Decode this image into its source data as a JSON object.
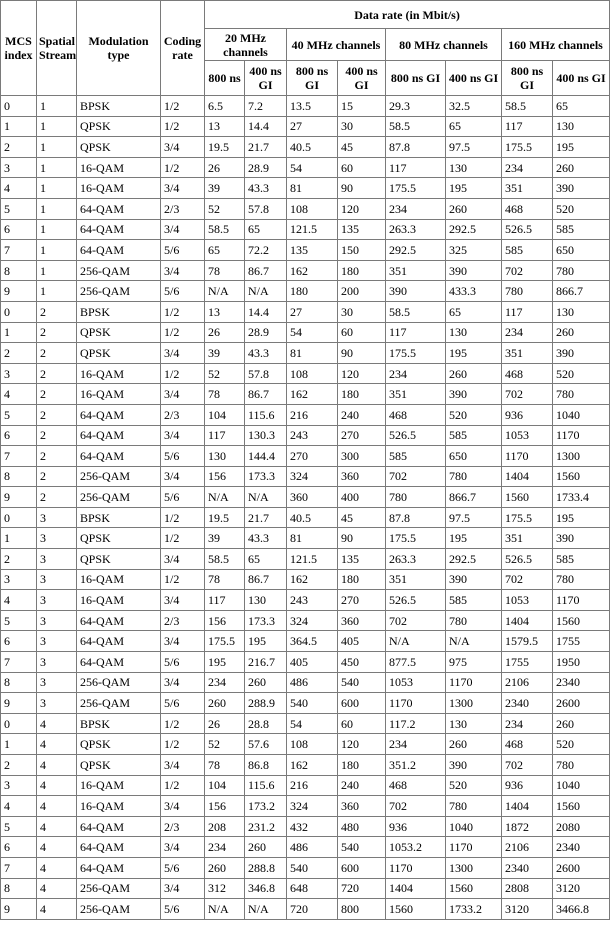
{
  "headers": {
    "mcs_index": "MCS index",
    "spatial_streams": "Spatial Streams",
    "modulation_type": "Modulation type",
    "coding_rate": "Coding rate",
    "data_rate": "Data rate (in Mbit/s)",
    "channels": [
      {
        "label": "20 MHz channels",
        "gi": [
          "800 ns",
          "400 ns GI"
        ]
      },
      {
        "label": "40 MHz channels",
        "gi": [
          "800 ns GI",
          "400 ns GI"
        ]
      },
      {
        "label": "80 MHz channels",
        "gi": [
          "800 ns GI",
          "400 ns GI"
        ]
      },
      {
        "label": "160 MHz channels",
        "gi": [
          "800 ns GI",
          "400 ns GI"
        ]
      }
    ]
  },
  "rows": [
    [
      "0",
      "1",
      "BPSK",
      "1/2",
      "6.5",
      "7.2",
      "13.5",
      "15",
      "29.3",
      "32.5",
      "58.5",
      "65"
    ],
    [
      "1",
      "1",
      "QPSK",
      "1/2",
      "13",
      "14.4",
      "27",
      "30",
      "58.5",
      "65",
      "117",
      "130"
    ],
    [
      "2",
      "1",
      "QPSK",
      "3/4",
      "19.5",
      "21.7",
      "40.5",
      "45",
      "87.8",
      "97.5",
      "175.5",
      "195"
    ],
    [
      "3",
      "1",
      "16-QAM",
      "1/2",
      "26",
      "28.9",
      "54",
      "60",
      "117",
      "130",
      "234",
      "260"
    ],
    [
      "4",
      "1",
      "16-QAM",
      "3/4",
      "39",
      "43.3",
      "81",
      "90",
      "175.5",
      "195",
      "351",
      "390"
    ],
    [
      "5",
      "1",
      "64-QAM",
      "2/3",
      "52",
      "57.8",
      "108",
      "120",
      "234",
      "260",
      "468",
      "520"
    ],
    [
      "6",
      "1",
      "64-QAM",
      "3/4",
      "58.5",
      "65",
      "121.5",
      "135",
      "263.3",
      "292.5",
      "526.5",
      "585"
    ],
    [
      "7",
      "1",
      "64-QAM",
      "5/6",
      "65",
      "72.2",
      "135",
      "150",
      "292.5",
      "325",
      "585",
      "650"
    ],
    [
      "8",
      "1",
      "256-QAM",
      "3/4",
      "78",
      "86.7",
      "162",
      "180",
      "351",
      "390",
      "702",
      "780"
    ],
    [
      "9",
      "1",
      "256-QAM",
      "5/6",
      "N/A",
      "N/A",
      "180",
      "200",
      "390",
      "433.3",
      "780",
      "866.7"
    ],
    [
      "0",
      "2",
      "BPSK",
      "1/2",
      "13",
      "14.4",
      "27",
      "30",
      "58.5",
      "65",
      "117",
      "130"
    ],
    [
      "1",
      "2",
      "QPSK",
      "1/2",
      "26",
      "28.9",
      "54",
      "60",
      "117",
      "130",
      "234",
      "260"
    ],
    [
      "2",
      "2",
      "QPSK",
      "3/4",
      "39",
      "43.3",
      "81",
      "90",
      "175.5",
      "195",
      "351",
      "390"
    ],
    [
      "3",
      "2",
      "16-QAM",
      "1/2",
      "52",
      "57.8",
      "108",
      "120",
      "234",
      "260",
      "468",
      "520"
    ],
    [
      "4",
      "2",
      "16-QAM",
      "3/4",
      "78",
      "86.7",
      "162",
      "180",
      "351",
      "390",
      "702",
      "780"
    ],
    [
      "5",
      "2",
      "64-QAM",
      "2/3",
      "104",
      "115.6",
      "216",
      "240",
      "468",
      "520",
      "936",
      "1040"
    ],
    [
      "6",
      "2",
      "64-QAM",
      "3/4",
      "117",
      "130.3",
      "243",
      "270",
      "526.5",
      "585",
      "1053",
      "1170"
    ],
    [
      "7",
      "2",
      "64-QAM",
      "5/6",
      "130",
      "144.4",
      "270",
      "300",
      "585",
      "650",
      "1170",
      "1300"
    ],
    [
      "8",
      "2",
      "256-QAM",
      "3/4",
      "156",
      "173.3",
      "324",
      "360",
      "702",
      "780",
      "1404",
      "1560"
    ],
    [
      "9",
      "2",
      "256-QAM",
      "5/6",
      "N/A",
      "N/A",
      "360",
      "400",
      "780",
      "866.7",
      "1560",
      "1733.4"
    ],
    [
      "0",
      "3",
      "BPSK",
      "1/2",
      "19.5",
      "21.7",
      "40.5",
      "45",
      "87.8",
      "97.5",
      "175.5",
      "195"
    ],
    [
      "1",
      "3",
      "QPSK",
      "1/2",
      "39",
      "43.3",
      "81",
      "90",
      "175.5",
      "195",
      "351",
      "390"
    ],
    [
      "2",
      "3",
      "QPSK",
      "3/4",
      "58.5",
      "65",
      "121.5",
      "135",
      "263.3",
      "292.5",
      "526.5",
      "585"
    ],
    [
      "3",
      "3",
      "16-QAM",
      "1/2",
      "78",
      "86.7",
      "162",
      "180",
      "351",
      "390",
      "702",
      "780"
    ],
    [
      "4",
      "3",
      "16-QAM",
      "3/4",
      "117",
      "130",
      "243",
      "270",
      "526.5",
      "585",
      "1053",
      "1170"
    ],
    [
      "5",
      "3",
      "64-QAM",
      "2/3",
      "156",
      "173.3",
      "324",
      "360",
      "702",
      "780",
      "1404",
      "1560"
    ],
    [
      "6",
      "3",
      "64-QAM",
      "3/4",
      "175.5",
      "195",
      "364.5",
      "405",
      "N/A",
      "N/A",
      "1579.5",
      "1755"
    ],
    [
      "7",
      "3",
      "64-QAM",
      "5/6",
      "195",
      "216.7",
      "405",
      "450",
      "877.5",
      "975",
      "1755",
      "1950"
    ],
    [
      "8",
      "3",
      "256-QAM",
      "3/4",
      "234",
      "260",
      "486",
      "540",
      "1053",
      "1170",
      "2106",
      "2340"
    ],
    [
      "9",
      "3",
      "256-QAM",
      "5/6",
      "260",
      "288.9",
      "540",
      "600",
      "1170",
      "1300",
      "2340",
      "2600"
    ],
    [
      "0",
      "4",
      "BPSK",
      "1/2",
      "26",
      "28.8",
      "54",
      "60",
      "117.2",
      "130",
      "234",
      "260"
    ],
    [
      "1",
      "4",
      "QPSK",
      "1/2",
      "52",
      "57.6",
      "108",
      "120",
      "234",
      "260",
      "468",
      "520"
    ],
    [
      "2",
      "4",
      "QPSK",
      "3/4",
      "78",
      "86.8",
      "162",
      "180",
      "351.2",
      "390",
      "702",
      "780"
    ],
    [
      "3",
      "4",
      "16-QAM",
      "1/2",
      "104",
      "115.6",
      "216",
      "240",
      "468",
      "520",
      "936",
      "1040"
    ],
    [
      "4",
      "4",
      "16-QAM",
      "3/4",
      "156",
      "173.2",
      "324",
      "360",
      "702",
      "780",
      "1404",
      "1560"
    ],
    [
      "5",
      "4",
      "64-QAM",
      "2/3",
      "208",
      "231.2",
      "432",
      "480",
      "936",
      "1040",
      "1872",
      "2080"
    ],
    [
      "6",
      "4",
      "64-QAM",
      "3/4",
      "234",
      "260",
      "486",
      "540",
      "1053.2",
      "1170",
      "2106",
      "2340"
    ],
    [
      "7",
      "4",
      "64-QAM",
      "5/6",
      "260",
      "288.8",
      "540",
      "600",
      "1170",
      "1300",
      "2340",
      "2600"
    ],
    [
      "8",
      "4",
      "256-QAM",
      "3/4",
      "312",
      "346.8",
      "648",
      "720",
      "1404",
      "1560",
      "2808",
      "3120"
    ],
    [
      "9",
      "4",
      "256-QAM",
      "5/6",
      "N/A",
      "N/A",
      "720",
      "800",
      "1560",
      "1733.2",
      "3120",
      "3466.8"
    ]
  ]
}
